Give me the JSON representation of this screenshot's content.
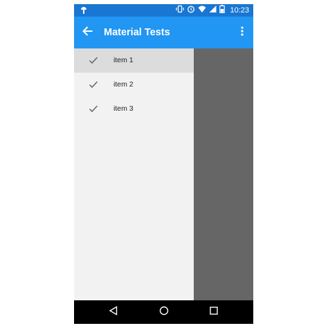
{
  "status_bar": {
    "time": "10:23",
    "icons": [
      "android-debug-icon",
      "vibrate-icon",
      "alarm-icon",
      "wifi-icon",
      "signal-icon",
      "battery-icon"
    ]
  },
  "app_bar": {
    "title": "Material Tests",
    "back_icon": "arrow-left-icon",
    "overflow_icon": "more-vert-icon"
  },
  "drawer": {
    "items": [
      {
        "label": "item 1",
        "icon": "check-icon",
        "selected": true
      },
      {
        "label": "item 2",
        "icon": "check-icon",
        "selected": false
      },
      {
        "label": "item 3",
        "icon": "check-icon",
        "selected": false
      }
    ]
  },
  "nav_bar": {
    "buttons": [
      "back-triangle-icon",
      "home-circle-icon",
      "recents-square-icon"
    ]
  },
  "colors": {
    "status_bar": "#1976d2",
    "app_bar": "#2196f3",
    "drawer_bg": "#f2f2f2",
    "selected_item": "#dcdcdc",
    "scrim": "#666666",
    "nav_bar": "#000000"
  }
}
